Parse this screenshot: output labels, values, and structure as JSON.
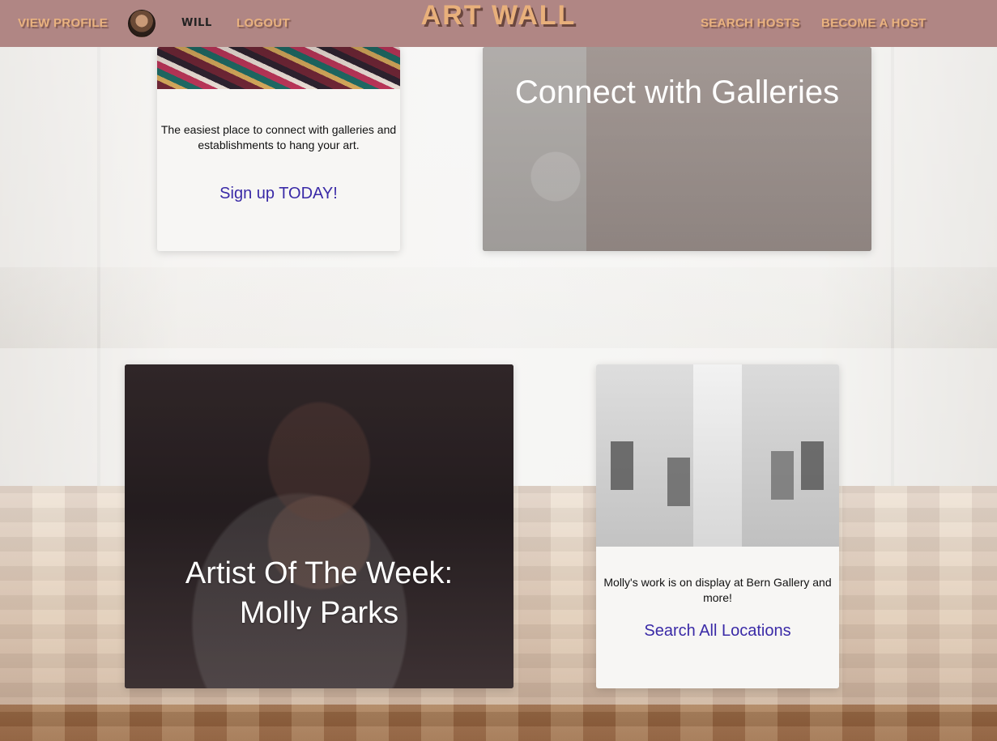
{
  "nav": {
    "view_profile": "VIEW PROFILE",
    "user_name": "WILL",
    "logout": "LOGOUT",
    "brand": "ART WALL",
    "search_hosts": "SEARCH HOSTS",
    "become_host": "BECOME A HOST"
  },
  "top_section": {
    "signup_card": {
      "description": "The easiest place to connect with galleries and establishments to hang your art.",
      "cta": "Sign up TODAY!"
    },
    "connect_card": {
      "title": "Connect with Galleries"
    }
  },
  "bottom_section": {
    "artist_card": {
      "title_line1": "Artist Of The Week:",
      "title_line2": "Molly Parks"
    },
    "locations_card": {
      "description": "Molly's work is on display at Bern Gallery and more!",
      "cta": "Search All Locations"
    }
  },
  "colors": {
    "nav_bg": "#b08684",
    "brand": "#e8b07b",
    "cta": "#3a2aa7"
  },
  "icons": {
    "avatar": "avatar"
  }
}
